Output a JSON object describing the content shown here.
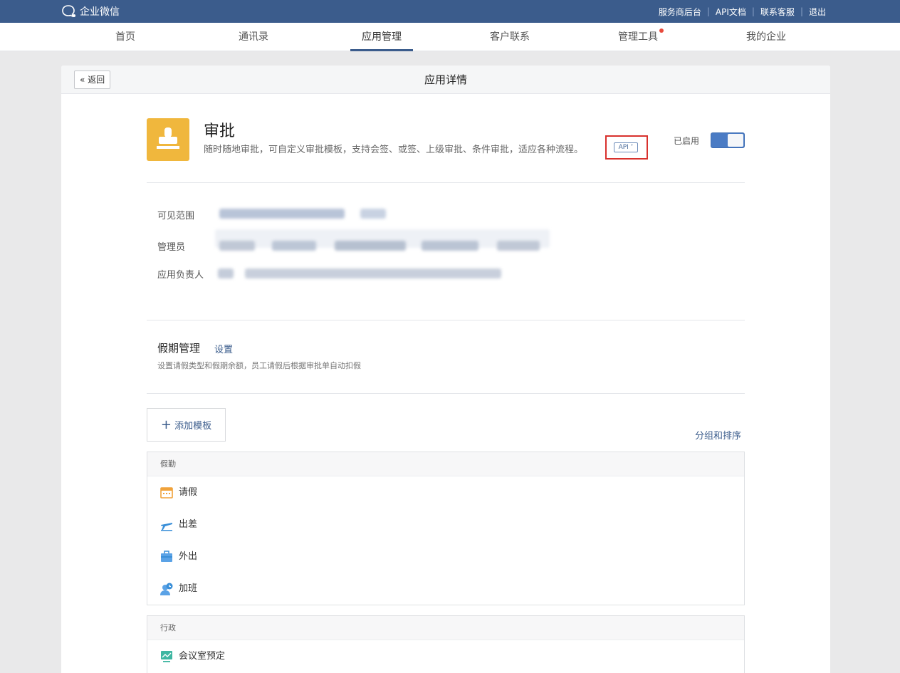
{
  "topbar": {
    "logo_text": "企业微信",
    "links": [
      "服务商后台",
      "API文档",
      "联系客服",
      "退出"
    ]
  },
  "nav": {
    "items": [
      "首页",
      "通讯录",
      "应用管理",
      "客户联系",
      "管理工具",
      "我的企业"
    ],
    "active": "应用管理"
  },
  "panel": {
    "back_label": "返回",
    "title": "应用详情"
  },
  "app": {
    "name": "审批",
    "description": "随时随地审批，可自定义审批模板，支持会签、或签、上级审批、条件审批，适应各种流程。",
    "api_tag": "API",
    "status_label": "已启用",
    "enabled": true,
    "icon_color": "#f0b73d"
  },
  "fields": {
    "visible_range_label": "可见范围",
    "admins_label": "管理员",
    "owner_label": "应用负责人"
  },
  "holiday": {
    "title": "假期管理",
    "setting_link": "设置",
    "description": "设置请假类型和假期余额，员工请假后根据审批单自动扣假"
  },
  "templates": {
    "add_label": "添加模板",
    "sort_link": "分组和排序",
    "groups": [
      {
        "name": "假勤",
        "items": [
          {
            "label": "请假",
            "icon": "calendar-icon"
          },
          {
            "label": "出差",
            "icon": "plane-icon"
          },
          {
            "label": "外出",
            "icon": "briefcase-icon"
          },
          {
            "label": "加班",
            "icon": "overtime-person-icon"
          }
        ]
      },
      {
        "name": "行政",
        "items": [
          {
            "label": "会议室预定",
            "icon": "meeting-room-icon"
          }
        ]
      }
    ]
  },
  "colors": {
    "brand": "#3b5c8c",
    "toggle_on": "#4a7bc4",
    "highlight_border": "#d8312d",
    "badge_red": "#e84a3b"
  }
}
